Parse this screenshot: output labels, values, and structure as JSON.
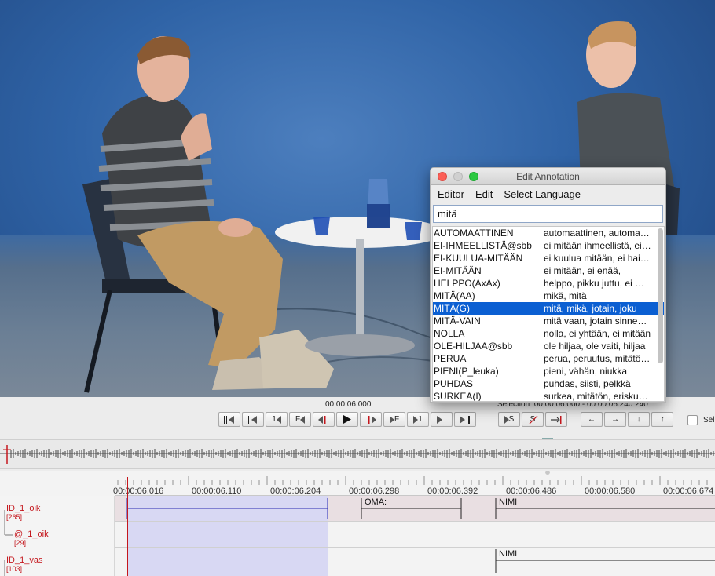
{
  "video": {
    "timecode": "00:00:06.000",
    "selection_text": "Selection: 00:00:06.000 - 00:00:06.240  240"
  },
  "controls": {
    "buttons": [
      {
        "name": "go-to-begin-button",
        "label": ""
      },
      {
        "name": "previous-frame-button",
        "label": ""
      },
      {
        "name": "step-back-1s-button",
        "label": "1"
      },
      {
        "name": "frame-back-button",
        "label": "F"
      },
      {
        "name": "previous-pixel-button",
        "label": ""
      },
      {
        "name": "play-button",
        "label": ""
      },
      {
        "name": "next-pixel-button",
        "label": ""
      },
      {
        "name": "frame-forward-button",
        "label": "F"
      },
      {
        "name": "step-forward-1s-button",
        "label": "1"
      },
      {
        "name": "next-frame-button",
        "label": ""
      },
      {
        "name": "go-to-end-button",
        "label": ""
      },
      {
        "name": "play-selection-button",
        "label": "S"
      },
      {
        "name": "clear-selection-button",
        "label": "S"
      },
      {
        "name": "selection-mode-button",
        "label": ""
      },
      {
        "name": "arrow-left-button",
        "label": "←"
      },
      {
        "name": "arrow-right-button",
        "label": "→"
      },
      {
        "name": "arrow-down-button",
        "label": "↓"
      },
      {
        "name": "arrow-up-button",
        "label": "↑"
      }
    ],
    "selection_checkbox_label": "Sel"
  },
  "timeline": {
    "ticks": [
      "00:00:06.016",
      "00:00:06.110",
      "00:00:06.204",
      "00:00:06.298",
      "00:00:06.392",
      "00:00:06.486",
      "00:00:06.580",
      "00:00:06.674"
    ],
    "tiers": [
      {
        "name": "ID_1_oik",
        "count": "[265]"
      },
      {
        "name": "@_1_oik",
        "count": "[29]"
      },
      {
        "name": "ID_1_vas",
        "count": "[103]"
      }
    ],
    "annotations": {
      "oma": "OMA:",
      "nimi_top": "NIMI",
      "nimi_bottom": "NIMI"
    }
  },
  "edit_window": {
    "title": "Edit Annotation",
    "menu": [
      "Editor",
      "Edit",
      "Select Language"
    ],
    "search_value": "mitä",
    "rows": [
      {
        "gloss": "AUTOMAATTINEN",
        "desc": "automaattinen, automaattisesti"
      },
      {
        "gloss": "EI-IHMEELLISTÄ@sbb",
        "desc": "ei mitään ihmeellistä, ei ihme"
      },
      {
        "gloss": "EI-KUULUA-MITÄÄN",
        "desc": "ei kuulua mitään, ei haittaa"
      },
      {
        "gloss": "EI-MITÄÄN",
        "desc": "ei mitään, ei enää,"
      },
      {
        "gloss": "HELPPO(AxAx)",
        "desc": "helppo, pikku juttu, ei mitään"
      },
      {
        "gloss": "MITÄ(AA)",
        "desc": "mikä, mitä"
      },
      {
        "gloss": "MITÄ(G)",
        "desc": "mitä, mikä, jotain, joku"
      },
      {
        "gloss": "MITÄ-VAIN",
        "desc": "mitä vaan, jotain sinnepäin"
      },
      {
        "gloss": "NOLLA",
        "desc": "nolla, ei yhtään, ei mitään"
      },
      {
        "gloss": "OLE-HILJAA@sbb",
        "desc": "ole hiljaa, ole vaiti, hiljaa"
      },
      {
        "gloss": "PERUA",
        "desc": "perua, peruutus, mitätöidä"
      },
      {
        "gloss": "PIENI(P_leuka)",
        "desc": "pieni, vähän, niukka"
      },
      {
        "gloss": "PUHDAS",
        "desc": "puhdas, siisti, pelkkä"
      },
      {
        "gloss": "SURKEA(I)",
        "desc": "surkea, mitätön, eriskummallinen"
      }
    ],
    "selected_index": 6
  },
  "colors": {
    "tier_label": "#c4161c",
    "selection_highlight": "#0b5fd2",
    "selected_interval": "#d8d8f3",
    "cursor": "#c4161c"
  }
}
